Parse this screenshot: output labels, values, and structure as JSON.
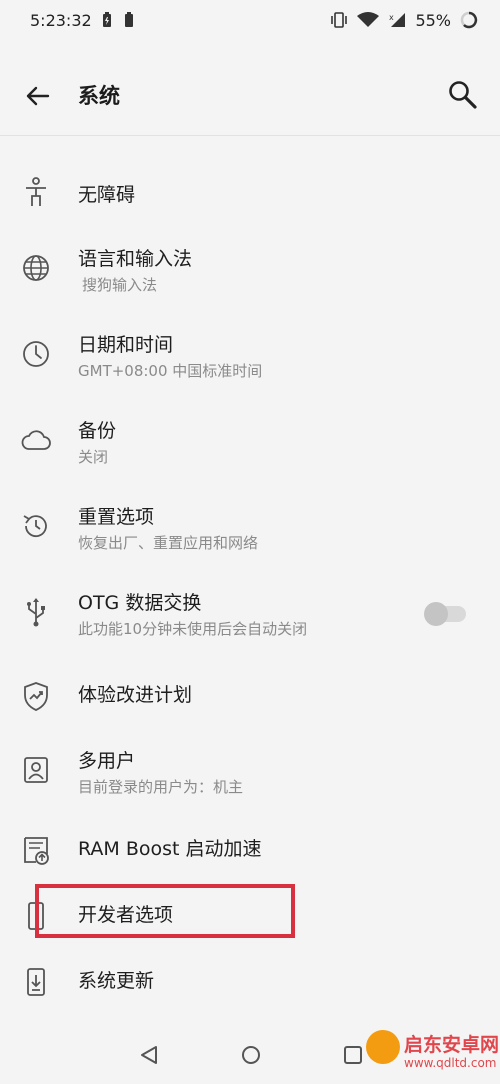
{
  "status_bar": {
    "time": "5:23:32",
    "battery_percent": "55%"
  },
  "app_bar": {
    "title": "系统"
  },
  "items": [
    {
      "label": "无障碍",
      "sub": "",
      "icon": "accessibility-icon"
    },
    {
      "label": "语言和输入法",
      "sub": "搜狗输入法",
      "icon": "globe-icon"
    },
    {
      "label": "日期和时间",
      "sub": "GMT+08:00 中国标准时间",
      "icon": "clock-icon"
    },
    {
      "label": "备份",
      "sub": "关闭",
      "icon": "cloud-icon"
    },
    {
      "label": "重置选项",
      "sub": "恢复出厂、重置应用和网络",
      "icon": "reset-history-icon"
    },
    {
      "label": "OTG 数据交换",
      "sub": "此功能10分钟未使用后会自动关闭",
      "icon": "usb-icon",
      "toggle": false
    },
    {
      "label": "体验改进计划",
      "sub": "",
      "icon": "shield-chart-icon"
    },
    {
      "label": "多用户",
      "sub": "目前登录的用户为：机主",
      "icon": "user-icon"
    },
    {
      "label": "RAM Boost 启动加速",
      "sub": "",
      "icon": "ram-boost-icon"
    },
    {
      "label": "开发者选项",
      "sub": "",
      "icon": "developer-icon"
    },
    {
      "label": "系统更新",
      "sub": "",
      "icon": "system-update-icon"
    }
  ],
  "watermark": {
    "text": "启东安卓网",
    "url": "www.qdltd.com"
  },
  "colors": {
    "highlight": "#d9303f",
    "background": "#f4f4f4"
  }
}
